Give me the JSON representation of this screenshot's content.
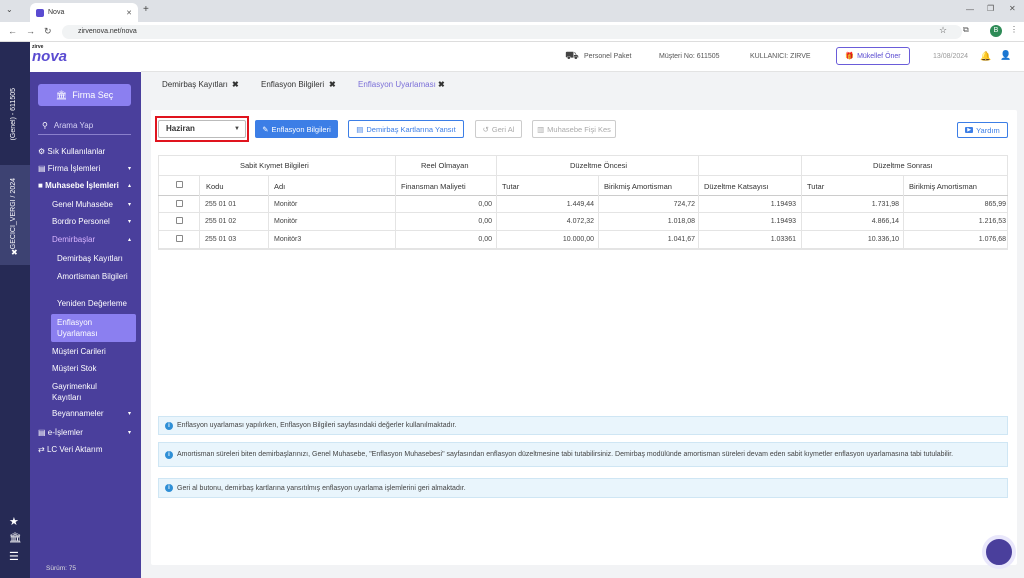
{
  "browser": {
    "tab_title": "Nova",
    "url": "zirvenova.net/nova",
    "profile_initial": "B"
  },
  "brand": {
    "logo_text": "nova",
    "logo_top": "zirve"
  },
  "strip": {
    "top_label": "(Genel) - 611505",
    "selected_label": "GECICI_VERGI / 2024"
  },
  "sidebar": {
    "firma_button": "Firma Seç",
    "search_placeholder": "Arama Yap",
    "items": [
      {
        "label": "Sık Kullanılanlar"
      },
      {
        "label": "Firma İşlemleri"
      },
      {
        "label": "Muhasebe İşlemleri"
      },
      {
        "label": "Genel Muhasebe"
      },
      {
        "label": "Bordro Personel"
      },
      {
        "label": "Demirbaşlar"
      },
      {
        "label": "Demirbaş Kayıtları"
      },
      {
        "label": "Amortisman Bilgileri"
      },
      {
        "label": "Yeniden Değerleme"
      },
      {
        "label": "Enflasyon Uyarlaması"
      },
      {
        "label": "Müşteri Carileri"
      },
      {
        "label": "Müşteri Stok"
      },
      {
        "label": "Gayrimenkul Kayıtları"
      },
      {
        "label": "Beyannameler"
      },
      {
        "label": "e-İşlemler"
      },
      {
        "label": "LC Veri Aktarım"
      }
    ],
    "version": "Sürüm: 75"
  },
  "header": {
    "package": "Personel Paket",
    "customer_no": "Müşteri No: 611505",
    "user": "KULLANICI: ZIRVE",
    "suggest_button": "Mükellef Öner",
    "date": "13/08/2024"
  },
  "page_tabs": [
    {
      "label": "Demirbaş Kayıtları"
    },
    {
      "label": "Enflasyon Bilgileri"
    },
    {
      "label": "Enflasyon Uyarlaması"
    }
  ],
  "toolbar": {
    "month_select": "Haziran",
    "btn_enflasyon_bilgileri": "Enflasyon Bilgileri",
    "btn_yansit": "Demirbaş Kartlarına Yansıt",
    "btn_geri_al": "Geri Al",
    "btn_fis_kes": "Muhasebe Fişi Kes",
    "btn_yardim": "Yardım"
  },
  "table": {
    "group_headers": [
      "Sabit Kıymet Bilgileri",
      "Reel Olmayan",
      "Düzeltme Öncesi",
      "Düzeltme Sonrası"
    ],
    "columns": [
      "Kodu",
      "Adı",
      "Finansman Maliyeti",
      "Tutar",
      "Birikmiş Amortisman",
      "Düzeltme Katsayısı",
      "Tutar",
      "Birikmiş Amortisman"
    ],
    "rows": [
      [
        "255 01 01",
        "Monitör",
        "0,00",
        "1.449,44",
        "724,72",
        "1.19493",
        "1.731,98",
        "865,99"
      ],
      [
        "255 01 02",
        "Monitör",
        "0,00",
        "4.072,32",
        "1.018,08",
        "1.19493",
        "4.866,14",
        "1.216,53"
      ],
      [
        "255 01 03",
        "Monitör3",
        "0,00",
        "10.000,00",
        "1.041,67",
        "1.03361",
        "10.336,10",
        "1.076,68"
      ]
    ]
  },
  "info": [
    "Enflasyon uyarlaması yapılırken, Enflasyon Bilgileri sayfasındaki değerler kullanılmaktadır.",
    "Amortisman süreleri biten demirbaşlarınızı, Genel Muhasebe, \"Enflasyon Muhasebesi\" sayfasından enflasyon düzeltmesine tabi tutabilirsiniz. Demirbaş modülünde amortisman süreleri devam eden sabit kıymetler enflasyon uyarlamasına tabi tutulabilir.",
    "Geri al butonu, demirbaş kartlarına yansıtılmış enflasyon uyarlama işlemlerini geri almaktadır."
  ],
  "colors": {
    "sidebar": "#4a3f9c",
    "accent": "#8b7ff0",
    "primary_button": "#3c7ee6",
    "highlight": "#e0141e"
  }
}
